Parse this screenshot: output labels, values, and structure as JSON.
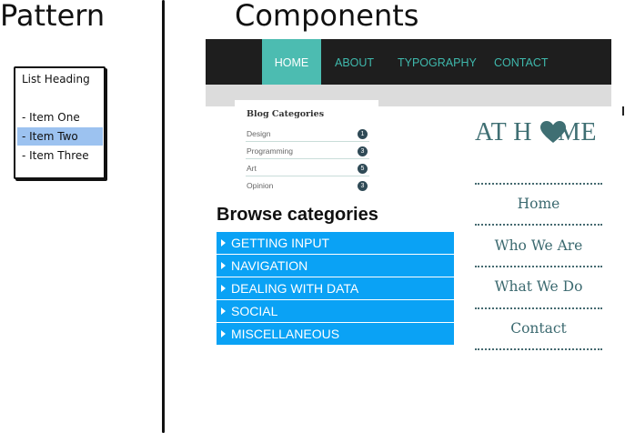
{
  "titles": {
    "pattern": "Pattern",
    "components": "Components"
  },
  "pattern_list": {
    "heading": "List Heading",
    "items": [
      {
        "label": "- Item One",
        "selected": false
      },
      {
        "label": "- Item Two",
        "selected": true
      },
      {
        "label": "- Item Three",
        "selected": false
      }
    ]
  },
  "nav": {
    "items": [
      {
        "label": "HOME",
        "active": true
      },
      {
        "label": "ABOUT",
        "active": false
      },
      {
        "label": "TYPOGRAPHY",
        "active": false
      },
      {
        "label": "CONTACT",
        "active": false
      }
    ]
  },
  "blog": {
    "title": "Blog Categories",
    "rows": [
      {
        "label": "Design",
        "count": "1"
      },
      {
        "label": "Programming",
        "count": "3"
      },
      {
        "label": "Art",
        "count": "5"
      },
      {
        "label": "Opinion",
        "count": "3"
      }
    ]
  },
  "browse": {
    "title": "Browse categories",
    "items": [
      "GETTING INPUT",
      "NAVIGATION",
      "DEALING WITH DATA",
      "SOCIAL",
      "MISCELLANEOUS"
    ]
  },
  "athome": {
    "brand_before": "AT H",
    "brand_after": "ME",
    "menu": [
      "Home",
      "Who We Are",
      "What We Do",
      "Contact"
    ]
  },
  "colors": {
    "nav_active": "#4cbcb1",
    "nav_text": "#3fb9ad",
    "browse_bg": "#0aa2f5",
    "brand_teal": "#3f6f73",
    "selected_item": "#9cc2f0"
  }
}
